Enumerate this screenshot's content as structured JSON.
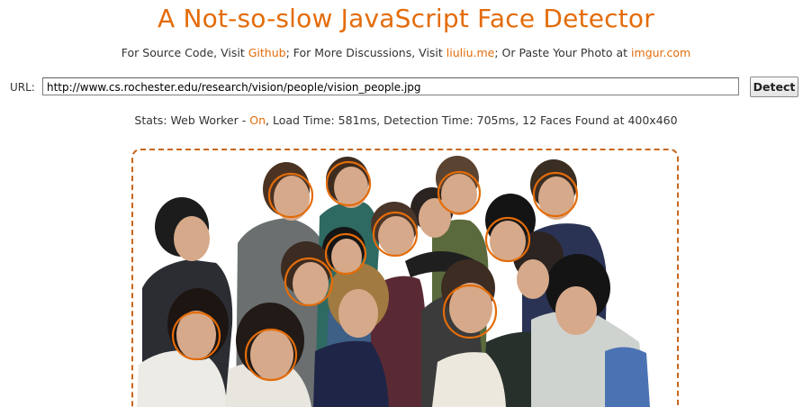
{
  "header": {
    "title": "A Not-so-slow JavaScript Face Detector",
    "subtitle": {
      "prefix": "For Source Code, Visit ",
      "github_link": "Github",
      "middle": "; For More Discussions, Visit ",
      "liuliu_link": "liuliu.me",
      "middle2": "; Or Paste Your Photo at ",
      "imgur_link": "imgur.com"
    }
  },
  "form": {
    "url_label": "URL:",
    "url_value": "http://www.cs.rochester.edu/research/vision/people/vision_people.jpg",
    "detect_label": "Detect"
  },
  "stats": {
    "prefix": "Stats: Web Worker - ",
    "worker_state": "On",
    "suffix": ", Load Time: 581ms, Detection Time: 705ms, 12 Faces Found at 400x460"
  },
  "colors": {
    "accent": "#e36c0a",
    "text": "#333333"
  },
  "photo": {
    "face_count": 12
  }
}
